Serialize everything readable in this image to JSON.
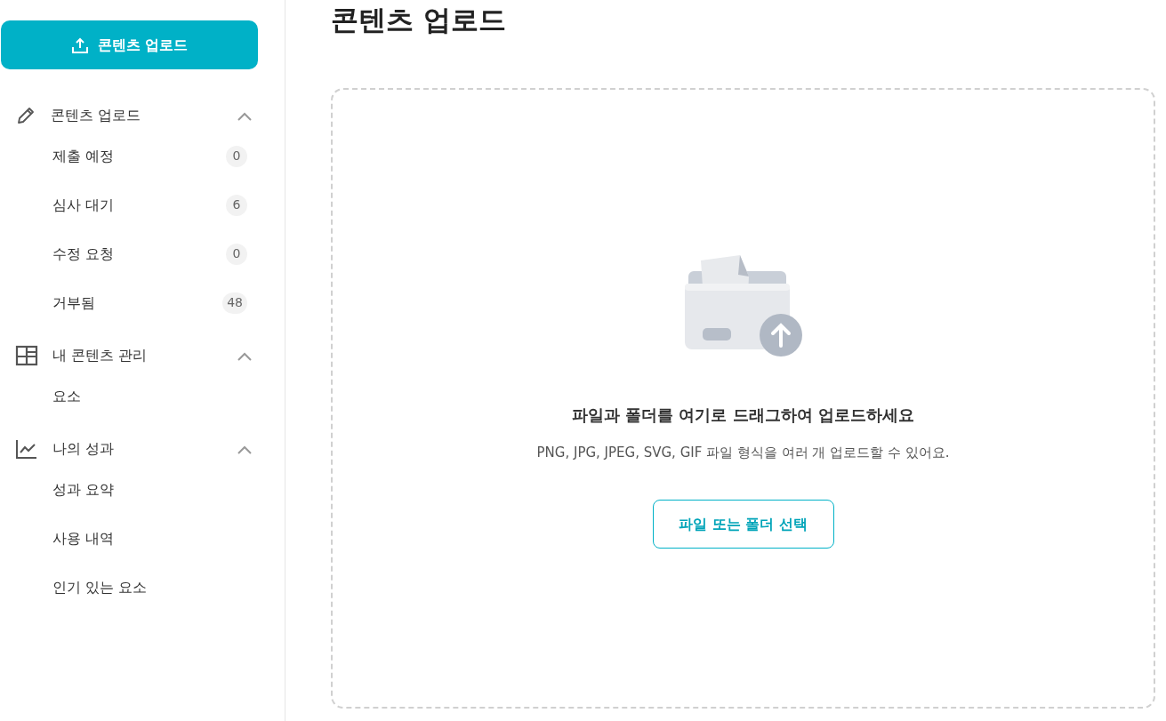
{
  "sidebar": {
    "upload_button": "콘텐츠 업로드",
    "sections": [
      {
        "title": "콘텐츠 업로드",
        "expanded": true,
        "items": [
          {
            "label": "제출 예정",
            "count": "0"
          },
          {
            "label": "심사 대기",
            "count": "6"
          },
          {
            "label": "수정 요청",
            "count": "0"
          },
          {
            "label": "거부됨",
            "count": "48"
          }
        ]
      },
      {
        "title": "내 콘텐츠 관리",
        "expanded": true,
        "items": [
          {
            "label": "요소"
          }
        ]
      },
      {
        "title": "나의 성과",
        "expanded": true,
        "items": [
          {
            "label": "성과 요약"
          },
          {
            "label": "사용 내역"
          },
          {
            "label": "인기 있는 요소"
          }
        ]
      }
    ]
  },
  "main": {
    "title": "콘텐츠 업로드",
    "dropzone": {
      "heading": "파일과 폴더를 여기로 드래그하여 업로드하세요",
      "hint": "PNG, JPG, JPEG, SVG, GIF 파일 형식을 여러 개 업로드할 수 있어요.",
      "button": "파일 또는 폴더 선택"
    }
  }
}
